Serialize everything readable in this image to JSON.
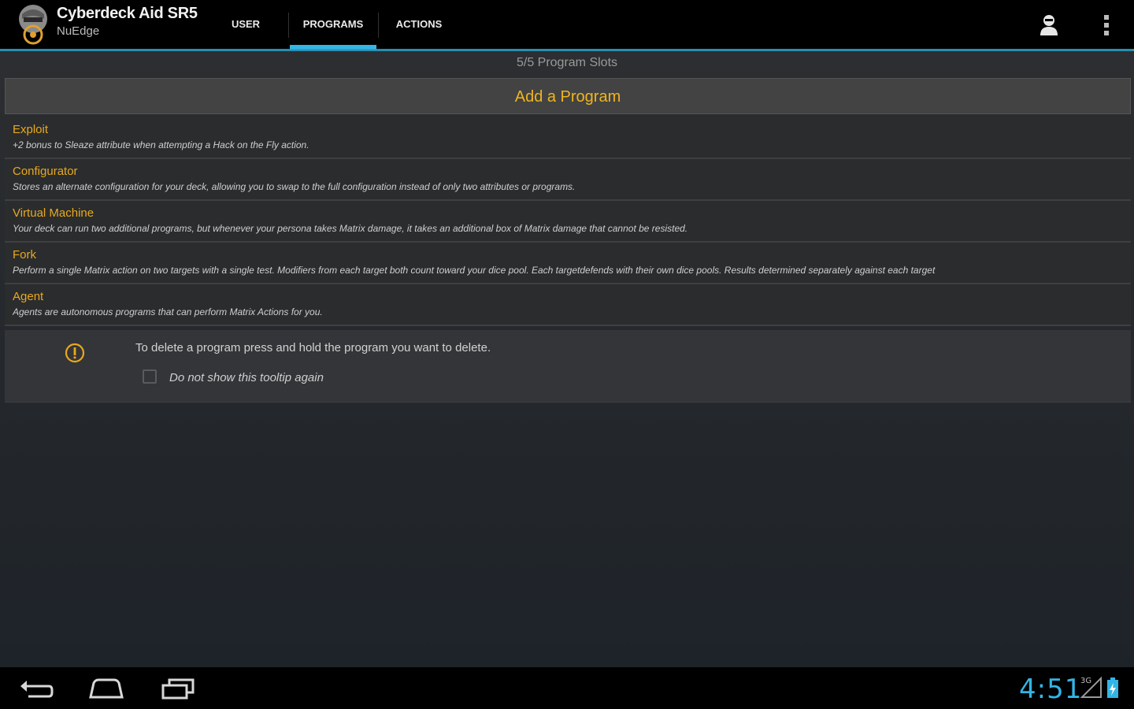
{
  "app": {
    "title": "Cyberdeck Aid SR5",
    "subtitle": "NuEdge"
  },
  "tabs": [
    {
      "label": "USER",
      "selected": false
    },
    {
      "label": "PROGRAMS",
      "selected": true
    },
    {
      "label": "ACTIONS",
      "selected": false
    }
  ],
  "slots_text": "5/5  Program Slots",
  "add_program_label": "Add a Program",
  "programs": [
    {
      "name": "Exploit",
      "description": "+2 bonus to Sleaze attribute when attempting a Hack on the Fly action."
    },
    {
      "name": "Configurator",
      "description": "Stores an alternate configuration for your deck, allowing you to swap to the full configuration instead of only two attributes or programs."
    },
    {
      "name": "Virtual Machine",
      "description": "Your deck can run two additional programs, but whenever your persona takes Matrix damage, it takes an additional box of Matrix damage that cannot be resisted."
    },
    {
      "name": "Fork",
      "description": "Perform a single Matrix action on two targets with a single test. Modifiers from each target both count toward your dice pool. Each targetdefends with their own dice pools. Results determined separately against each target"
    },
    {
      "name": "Agent",
      "description": "Agents are autonomous programs that can perform Matrix Actions for you."
    }
  ],
  "tooltip": {
    "text": "To delete a program press and hold the program you want to delete.",
    "checkbox_label": "Do not show this tooltip again",
    "checked": false
  },
  "status": {
    "time": "4:51",
    "network": "3G"
  },
  "colors": {
    "accent": "#33b5e5",
    "highlight": "#f0b51c"
  }
}
